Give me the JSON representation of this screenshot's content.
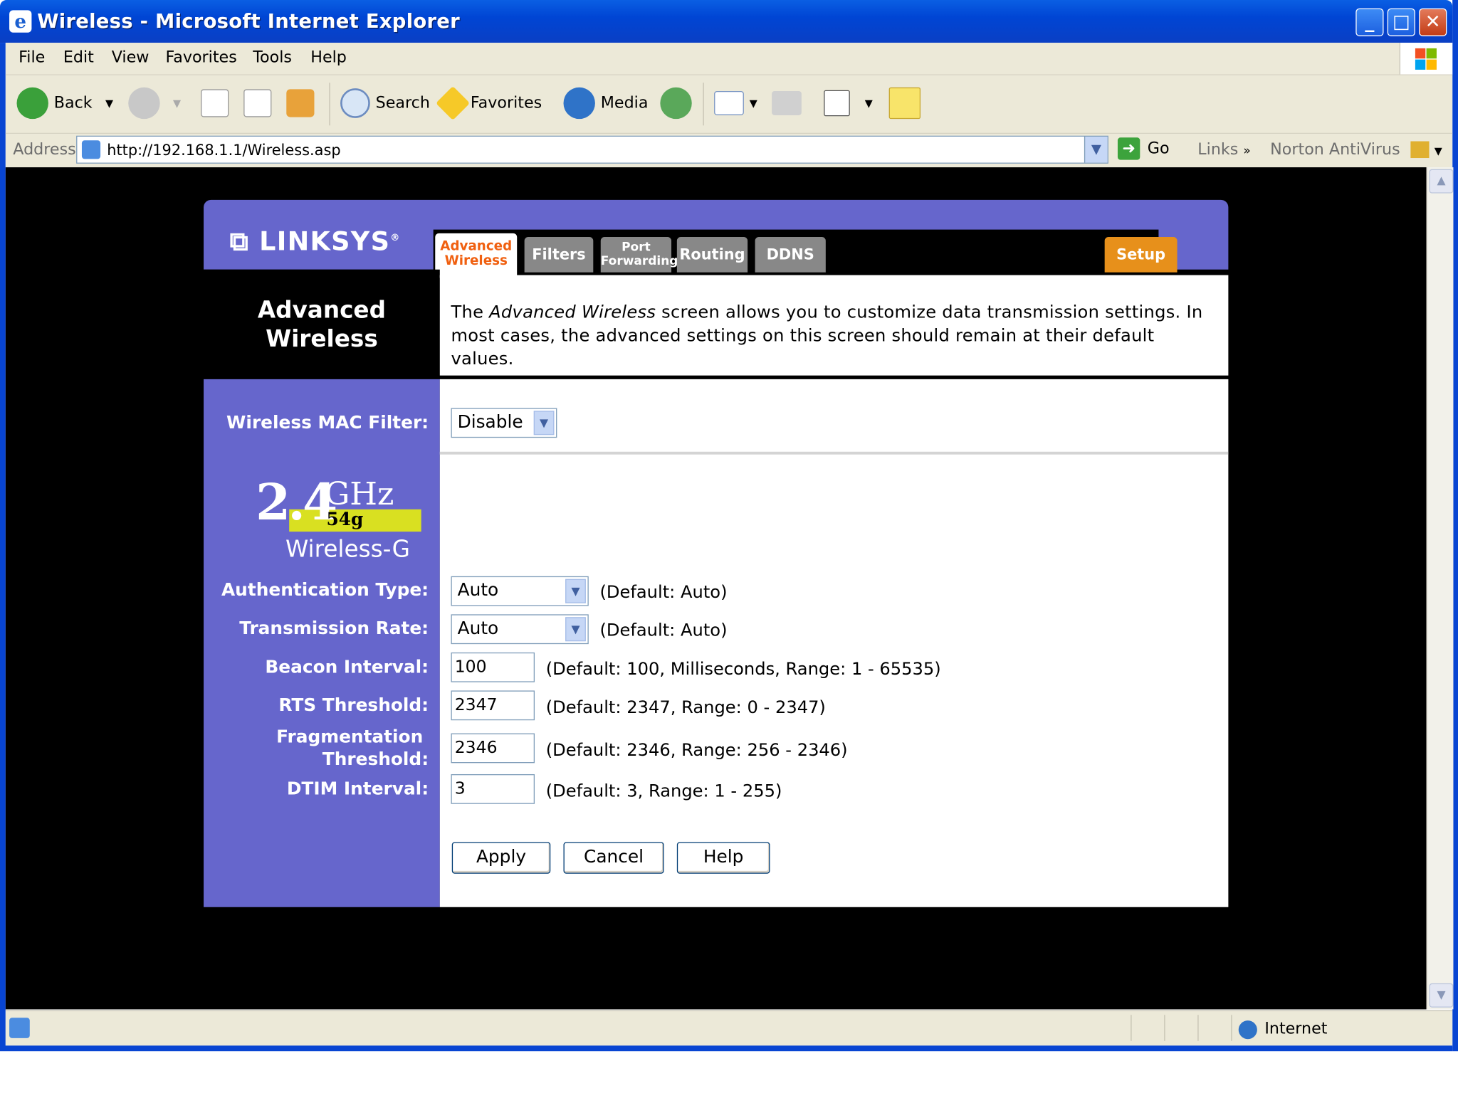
{
  "window": {
    "title": "Wireless - Microsoft Internet Explorer"
  },
  "menu": [
    "File",
    "Edit",
    "View",
    "Favorites",
    "Tools",
    "Help"
  ],
  "toolbar": {
    "back": "Back",
    "search": "Search",
    "favorites": "Favorites",
    "media": "Media"
  },
  "address": {
    "label": "Address",
    "url": "http://192.168.1.1/Wireless.asp",
    "go": "Go",
    "links": "Links",
    "norton": "Norton AntiVirus"
  },
  "page": {
    "logo": "LINKSYS",
    "tabs": [
      {
        "label": "Advanced Wireless",
        "line1": "Advanced",
        "line2": "Wireless"
      },
      {
        "label": "Filters"
      },
      {
        "label": "Port Forwarding",
        "line1": "Port",
        "line2": "Forwarding"
      },
      {
        "label": "Routing"
      },
      {
        "label": "DDNS"
      },
      {
        "label": "Setup"
      }
    ],
    "section_title_1": "Advanced",
    "section_title_2": "Wireless",
    "intro_pre": "The ",
    "intro_em": "Advanced Wireless",
    "intro_post": " screen allows you to customize data transmission settings. In most cases, the advanced settings on this screen should remain at their default values.",
    "badge": {
      "freq": "2.4",
      "unit": "GHz",
      "speed": "54g",
      "name": "Wireless-G"
    },
    "fields": {
      "mac_filter": {
        "label": "Wireless MAC Filter:",
        "value": "Disable"
      },
      "auth_type": {
        "label": "Authentication Type:",
        "value": "Auto",
        "hint": "(Default: Auto)"
      },
      "tx_rate": {
        "label": "Transmission Rate:",
        "value": "Auto",
        "hint": "(Default: Auto)"
      },
      "beacon": {
        "label": "Beacon Interval:",
        "value": "100",
        "hint": "(Default: 100, Milliseconds, Range: 1 - 65535)"
      },
      "rts": {
        "label": "RTS Threshold:",
        "value": "2347",
        "hint": "(Default: 2347, Range: 0 - 2347)"
      },
      "frag": {
        "label_1": "Fragmentation",
        "label_2": "Threshold:",
        "value": "2346",
        "hint": "(Default: 2346, Range: 256 - 2346)"
      },
      "dtim": {
        "label": "DTIM Interval:",
        "value": "3",
        "hint": "(Default: 3, Range: 1 - 255)"
      }
    },
    "buttons": {
      "apply": "Apply",
      "cancel": "Cancel",
      "help": "Help"
    }
  },
  "status": {
    "zone": "Internet"
  },
  "colors": {
    "linksys_purple": "#6666cc",
    "setup_orange": "#e7901b",
    "active_tab_text": "#f06010",
    "xp_blue": "#0845d2"
  }
}
